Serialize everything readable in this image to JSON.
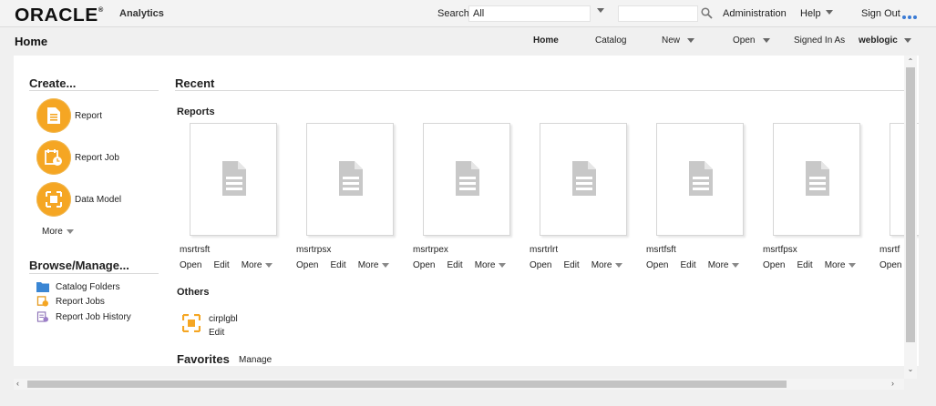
{
  "header": {
    "logo": "ORACLE",
    "product": "Analytics",
    "search_label": "Search",
    "search_scope": "All",
    "search_value": "",
    "administration": "Administration",
    "help": "Help",
    "sign_out": "Sign Out"
  },
  "subheader": {
    "page_title": "Home",
    "nav_home": "Home",
    "nav_catalog": "Catalog",
    "nav_new": "New",
    "nav_open": "Open",
    "signed_in_as": "Signed In As",
    "username": "weblogic"
  },
  "create": {
    "title": "Create...",
    "items": [
      {
        "label": "Report",
        "icon": "report-icon"
      },
      {
        "label": "Report Job",
        "icon": "report-job-icon"
      },
      {
        "label": "Data Model",
        "icon": "data-model-icon"
      }
    ],
    "more": "More"
  },
  "browse": {
    "title": "Browse/Manage...",
    "items": [
      {
        "label": "Catalog Folders",
        "icon": "folder-icon"
      },
      {
        "label": "Report Jobs",
        "icon": "report-jobs-icon"
      },
      {
        "label": "Report Job History",
        "icon": "job-history-icon"
      }
    ]
  },
  "recent": {
    "title": "Recent",
    "reports_title": "Reports",
    "reports": [
      {
        "name": "msrtrsft"
      },
      {
        "name": "msrtrpsx"
      },
      {
        "name": "msrtrpex"
      },
      {
        "name": "msrtrlrt"
      },
      {
        "name": "msrtfsft"
      },
      {
        "name": "msrtfpsx"
      },
      {
        "name": "msrtf"
      }
    ],
    "actions": {
      "open": "Open",
      "edit": "Edit",
      "more": "More"
    },
    "others_title": "Others",
    "others": [
      {
        "name": "cirplgbl",
        "action": "Edit"
      }
    ]
  },
  "favorites": {
    "title": "Favorites",
    "manage": "Manage"
  },
  "colors": {
    "accent_orange": "#f5a623",
    "folder_blue": "#3a86d4",
    "doc_gray": "#c8c8c8"
  }
}
